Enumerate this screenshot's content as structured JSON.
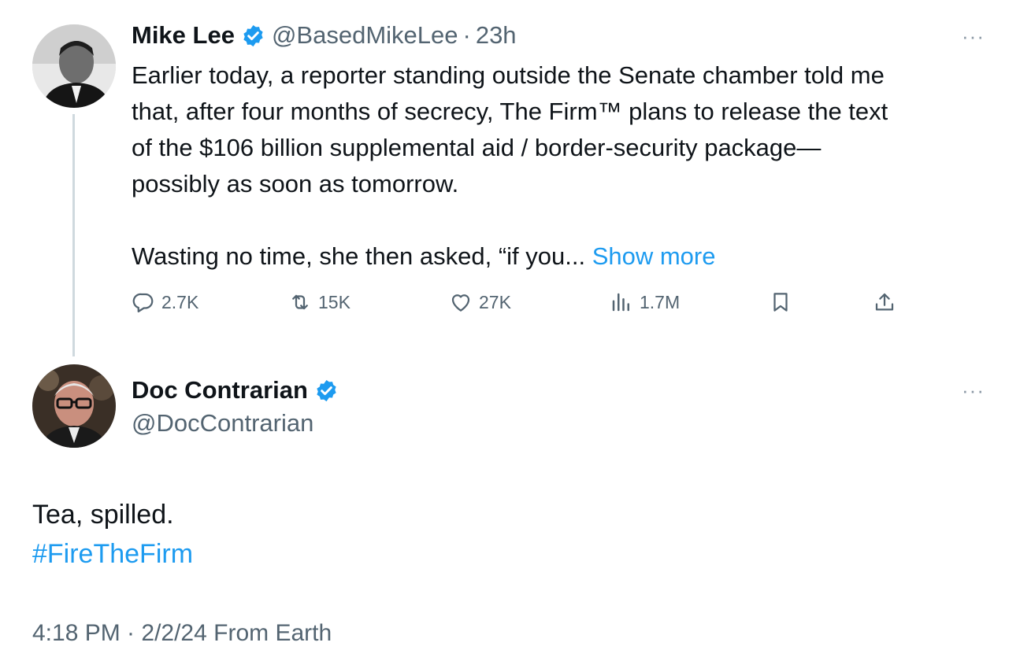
{
  "parent_tweet": {
    "display_name": "Mike Lee",
    "handle": "@BasedMikeLee",
    "separator": "·",
    "time_ago": "23h",
    "more_label": "···",
    "text_lines": [
      "Earlier today, a reporter standing outside the Senate chamber told me",
      "that, after four months of secrecy, The Firm™ plans to release the text",
      "of the $106 billion supplemental aid / border-security package—",
      "possibly as soon as tomorrow."
    ],
    "text_truncated": "Wasting no time, she then asked, “if you...",
    "show_more_label": "Show more",
    "actions": {
      "replies": "2.7K",
      "reposts": "15K",
      "likes": "27K",
      "views": "1.7M"
    }
  },
  "reply_tweet": {
    "display_name": "Doc Contrarian",
    "handle": "@DocContrarian",
    "more_label": "···",
    "text": "Tea, spilled.",
    "hashtag": "#FireTheFirm",
    "timestamp": "4:18 PM · 2/2/24 From Earth"
  },
  "colors": {
    "text": "#0f1419",
    "secondary": "#536471",
    "accent_blue": "#1d9bf0",
    "thread_line": "#cfd9de"
  }
}
